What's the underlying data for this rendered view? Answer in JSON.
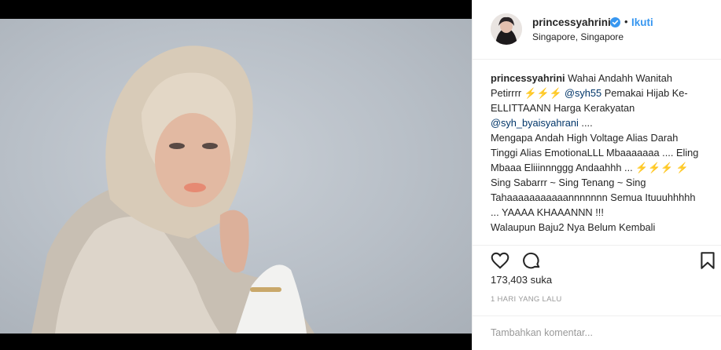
{
  "post": {
    "username": "princessyahrini",
    "follow_label": "Ikuti",
    "dot": "•",
    "location": "Singapore, Singapore",
    "caption_user": "princessyahrini",
    "caption_intro": "Wahai Andahh Wanitah Petirrrr ⚡⚡⚡ ",
    "mention1": "@syh55",
    "caption_part2": " Pemakai Hijab Ke-ELLITTAANN Harga Kerakyatan ",
    "mention2": "@syh_byaisyahrani",
    "caption_part3": " ....",
    "line_mengapa": "Mengapa Andah High Voltage Alias Darah Tinggi Alias EmotionaLLL Mbaaaaaaa .... Eling Mbaaa Eliiinnnggg Andaahhh ... ⚡⚡⚡ ⚡",
    "line_sing": "Sing Sabarrr ~ Sing Tenang ~ Sing Tahaaaaaaaaaaannnnnnn Semua Ituuuhhhhh ... YAAAA KHAAANNN !!!",
    "line_walau": "Walaupun Baju2 Nya Belum Kembali",
    "likes": "173,403 suka",
    "time": "1 HARI YANG LALU",
    "comment_placeholder": "Tambahkan komentar..."
  },
  "icons": [
    "verified-badge-icon",
    "heart-icon",
    "comment-icon",
    "bookmark-icon"
  ],
  "colors": {
    "link": "#3897f0",
    "mention": "#003569",
    "text": "#262626",
    "muted": "#999999",
    "border": "#efefef"
  }
}
